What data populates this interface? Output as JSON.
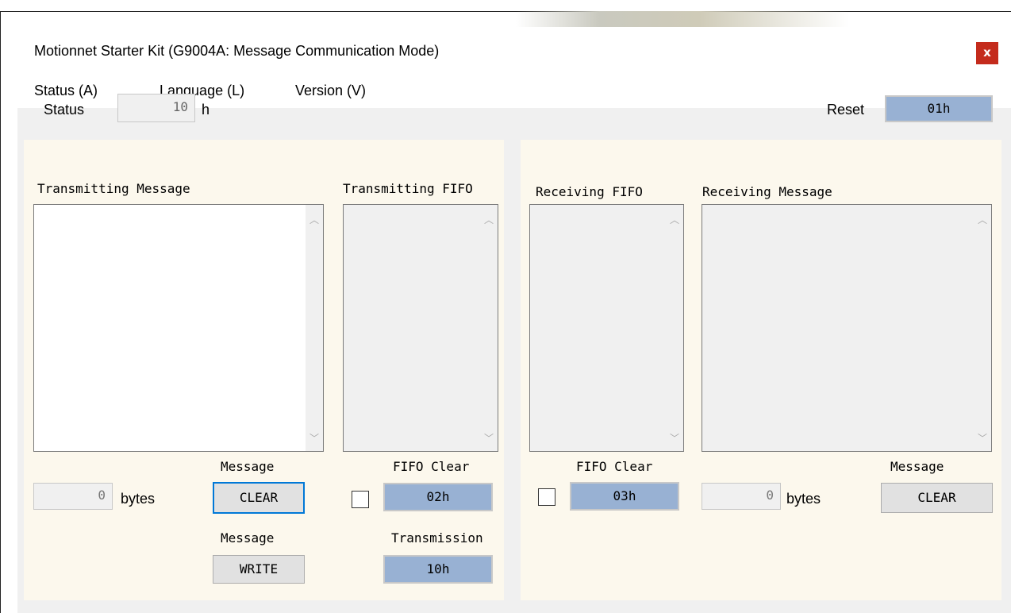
{
  "window": {
    "title": "Motionnet Starter Kit (G9004A: Message Communication Mode)",
    "close_glyph": "x"
  },
  "menu": {
    "items": [
      {
        "label": "Status (A)"
      },
      {
        "label": "Language (L)"
      },
      {
        "label": "Version (V)"
      }
    ]
  },
  "status": {
    "label": "Status",
    "value": "10",
    "unit": "h"
  },
  "reset": {
    "label": "Reset",
    "button": "01h"
  },
  "transmitting_message": {
    "title": "Transmitting Message",
    "text": "",
    "bytes_value": "0",
    "bytes_unit": "bytes",
    "clear_caption": "Message",
    "clear_button": "CLEAR",
    "write_caption": "Message",
    "write_button": "WRITE"
  },
  "transmitting_fifo": {
    "title": "Transmitting FIFO",
    "clear_caption": "FIFO Clear",
    "clear_button": "02h",
    "transmission_caption": "Transmission",
    "transmission_button": "10h"
  },
  "receiving_fifo": {
    "title": "Receiving FIFO",
    "clear_caption": "FIFO Clear",
    "clear_button": "03h"
  },
  "receiving_message": {
    "title": "Receiving Message",
    "bytes_value": "0",
    "bytes_unit": "bytes",
    "clear_caption": "Message",
    "clear_button": "CLEAR"
  },
  "icons": {
    "scroll_up": "chevron-up-icon",
    "scroll_down": "chevron-down-icon"
  },
  "colors": {
    "accent_button": "#98b1d3",
    "panel_bg": "#fcf8ed",
    "close_button": "#c42b1c",
    "focus_border": "#0078d7"
  }
}
